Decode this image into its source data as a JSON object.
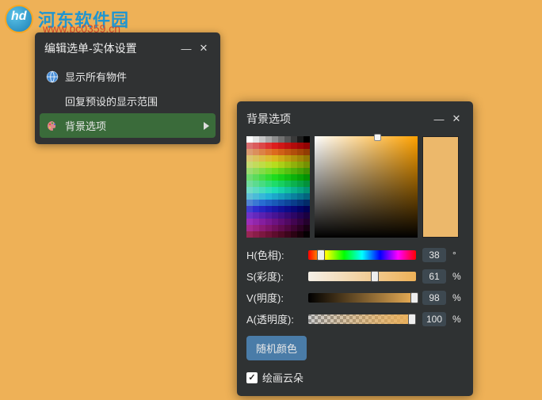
{
  "watermark": {
    "text": "河东软件园",
    "sub": "www.pc0359.cn"
  },
  "menu": {
    "title": "编辑选单-实体设置",
    "items": [
      {
        "label": "显示所有物件",
        "icon": "globe-icon",
        "hasSubmenu": false
      },
      {
        "label": "回复预设的显示范围",
        "icon": "",
        "hasSubmenu": false
      },
      {
        "label": "背景选项",
        "icon": "palette-icon",
        "hasSubmenu": true,
        "active": true
      }
    ]
  },
  "bgPanel": {
    "title": "背景选项",
    "hue": {
      "label": "H(色相):",
      "value": "38",
      "suffix": "°",
      "pct": 10
    },
    "sat": {
      "label": "S(彩度):",
      "value": "61",
      "suffix": "%",
      "pct": 61
    },
    "val": {
      "label": "V(明度):",
      "value": "98",
      "suffix": "%",
      "pct": 98
    },
    "alpha": {
      "label": "A(透明度):",
      "value": "100",
      "suffix": "%",
      "pct": 100
    },
    "randomBtn": "随机颜色",
    "drawClouds": {
      "label": "绘画云朵",
      "checked": true
    },
    "previewColor": "#ecb86b"
  }
}
